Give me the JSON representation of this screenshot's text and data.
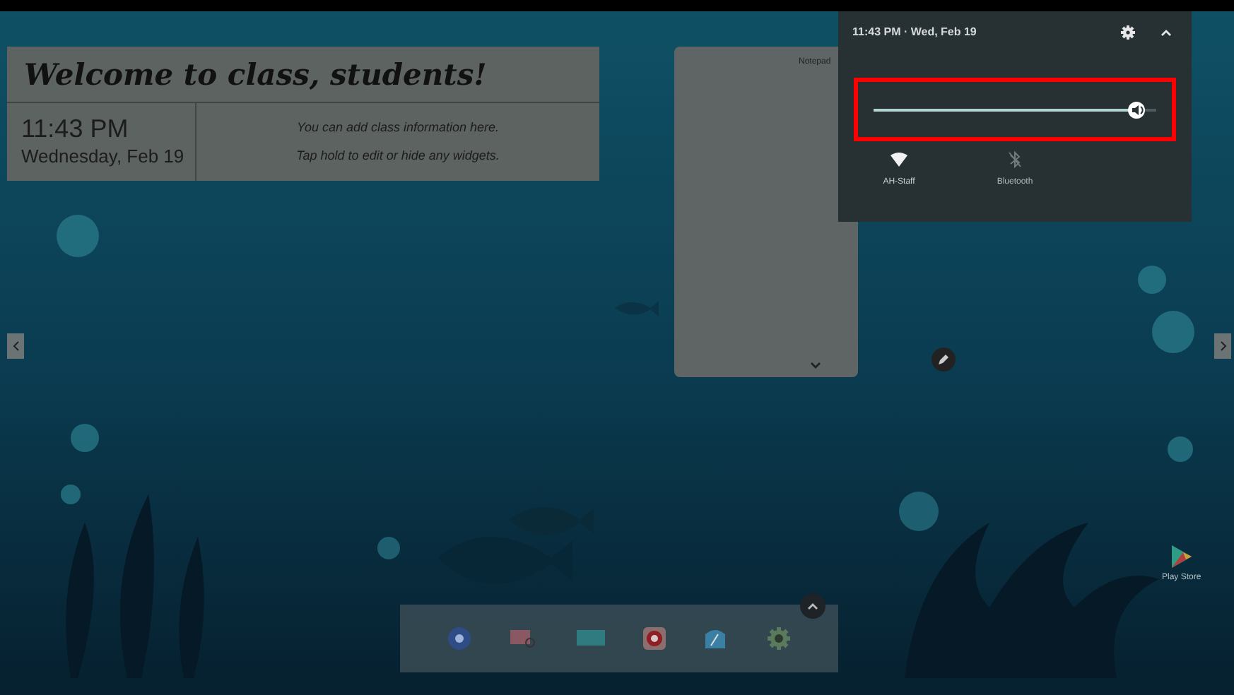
{
  "welcome_widget": {
    "title": "Welcome to class, students!",
    "time": "11:43 PM",
    "date": "Wednesday, Feb 19",
    "info_lines": [
      "You can add class information here.",
      "Tap hold to edit or hide any widgets."
    ]
  },
  "notepad_widget": {
    "title": "Notepad"
  },
  "quick_settings": {
    "datetime": "11:43 PM · Wed, Feb 19",
    "volume": {
      "level": 0.93,
      "highlighted": true
    },
    "tiles": [
      {
        "kind": "wifi",
        "label": "AH-Staff",
        "on": true
      },
      {
        "kind": "bluetooth",
        "label": "Bluetooth",
        "on": false
      }
    ]
  },
  "dock": {
    "apps": [
      {
        "kind": "chrome"
      },
      {
        "kind": "whiteboard"
      },
      {
        "kind": "screenshare"
      },
      {
        "kind": "red-app"
      },
      {
        "kind": "explorer"
      },
      {
        "kind": "settings"
      }
    ]
  },
  "desktop_apps": [
    {
      "kind": "play",
      "label": "Play Store"
    }
  ]
}
